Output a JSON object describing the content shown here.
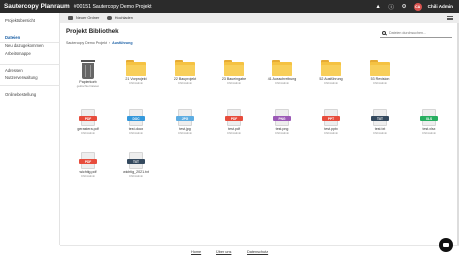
{
  "header": {
    "brand": "Sautercopy Planraum",
    "project": "#00151 Sautercopy Demo Projekt",
    "user_initials": "CA",
    "user_name": "Chili Admin",
    "colors": {
      "bar": "#2b2b2b",
      "avatar": "#d9534f"
    }
  },
  "toolbar": {
    "new_folder": "Neuer Ordner",
    "upload": "Hochladen"
  },
  "sidebar": {
    "items": [
      {
        "label": "Projektübersicht",
        "active": false
      },
      {
        "label": "Dateien",
        "active": true
      },
      {
        "label": "Neu dazugekommen",
        "active": false
      },
      {
        "label": "Arbeitsmappe",
        "active": false
      },
      {
        "label": "Adressen",
        "active": false
      },
      {
        "label": "Nutzerverwaltung",
        "active": false
      },
      {
        "label": "Onlinebestellung",
        "active": false
      }
    ]
  },
  "main": {
    "title": "Projekt Bibliothek",
    "breadcrumb": [
      "Sautercopy Demo Projekt",
      "Ausführung"
    ],
    "search_placeholder": "Dateien durchsuchen..."
  },
  "items": [
    {
      "name": "Papierkorb",
      "by": "gelöschte Dateien",
      "kind": "trash",
      "icon": "trash-icon"
    },
    {
      "name": "21 Vorprojekt",
      "by": "Chili Admin",
      "kind": "folder",
      "icon": "folder-icon"
    },
    {
      "name": "22 Bauprojekt",
      "by": "Chili Admin",
      "kind": "folder",
      "icon": "folder-icon"
    },
    {
      "name": "23 Baueingabe",
      "by": "Chili Admin",
      "kind": "folder",
      "icon": "folder-icon"
    },
    {
      "name": "41 Ausschreibung",
      "by": "Chili Admin",
      "kind": "folder",
      "icon": "folder-icon"
    },
    {
      "name": "52 Ausführung",
      "by": "Chili Admin",
      "kind": "folder",
      "icon": "folder-icon"
    },
    {
      "name": "53 Revision",
      "by": "Chili Admin",
      "kind": "folder",
      "icon": "folder-icon"
    },
    {
      "name": "gerastera.pdf",
      "by": "Chili Admin",
      "kind": "file",
      "ext": "PDF",
      "color": "#e74c3c",
      "icon": "pdf-file-icon"
    },
    {
      "name": "test.docx",
      "by": "Chili Admin",
      "kind": "file",
      "ext": "DOC",
      "color": "#3498db",
      "icon": "doc-file-icon"
    },
    {
      "name": "test.jpg",
      "by": "Chili Admin",
      "kind": "file",
      "ext": "JPG",
      "color": "#5dade2",
      "icon": "jpg-file-icon"
    },
    {
      "name": "test.pdf",
      "by": "Chili Admin",
      "kind": "file",
      "ext": "PDF",
      "color": "#e74c3c",
      "icon": "pdf-file-icon"
    },
    {
      "name": "test.png",
      "by": "Chili Admin",
      "kind": "file",
      "ext": "PNG",
      "color": "#9b59b6",
      "icon": "png-file-icon"
    },
    {
      "name": "test.pptx",
      "by": "Chili Admin",
      "kind": "file",
      "ext": "PPT",
      "color": "#e74c3c",
      "icon": "ppt-file-icon"
    },
    {
      "name": "test.txt",
      "by": "Chili Admin",
      "kind": "file",
      "ext": "TXT",
      "color": "#34495e",
      "icon": "txt-file-icon"
    },
    {
      "name": "test.xlsx",
      "by": "Chili Admin",
      "kind": "file",
      "ext": "XLS",
      "color": "#27ae60",
      "icon": "xls-file-icon"
    },
    {
      "name": "wichtig.pdf",
      "by": "Chili Admin",
      "kind": "file",
      "ext": "PDF",
      "color": "#e74c3c",
      "icon": "pdf-file-icon"
    },
    {
      "name": "wichtig_2021.txt",
      "by": "Chili Admin",
      "kind": "file",
      "ext": "TXT",
      "color": "#34495e",
      "icon": "txt-file-icon"
    }
  ],
  "footer": {
    "links": [
      "Home",
      "Über uns",
      "Datenschutz"
    ]
  }
}
